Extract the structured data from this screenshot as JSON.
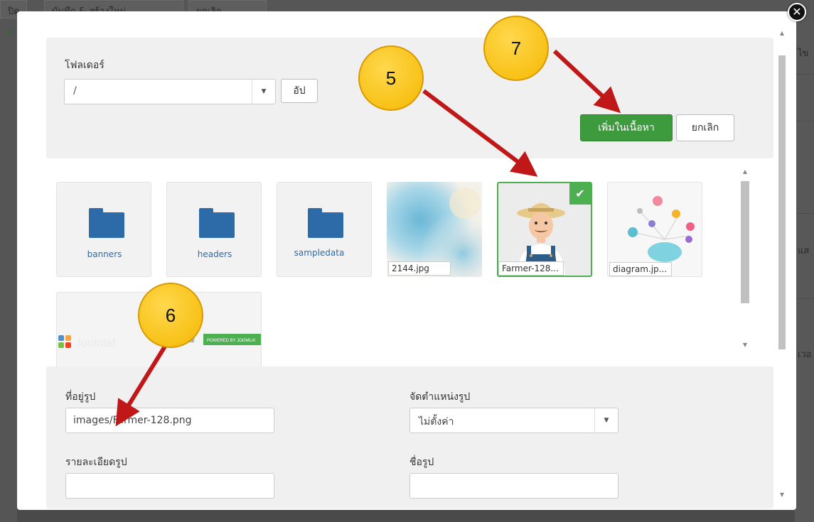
{
  "background": {
    "toolbar_buttons": [
      "ปิด",
      "บันทึก & สร้างใหม่",
      "ยกเลิก"
    ],
    "right_snippets": [
      "ไข",
      "แส",
      "เวอ"
    ]
  },
  "modal": {
    "close_icon": "close-icon",
    "folder_section": {
      "label": "โฟลเดอร์",
      "selected_folder": "/",
      "up_button": "อัป",
      "insert_button": "เพิ่มในเนื้อหา",
      "cancel_button": "ยกเลิก"
    },
    "media": {
      "folders": [
        {
          "name": "banners"
        },
        {
          "name": "headers"
        },
        {
          "name": "sampledata"
        }
      ],
      "images": [
        {
          "label": "2144.jpg"
        },
        {
          "label": "Farmer-128...",
          "selected": true
        },
        {
          "label": "diagram.jp..."
        }
      ],
      "joomla_banner": {
        "logo_text": "Joomla!",
        "small_text": "Joomla!",
        "powered_text": "POWERED BY JOOMLA!"
      }
    },
    "details": {
      "image_url_label": "ที่อยู่รูป",
      "image_url_value": "images/Farmer-128.png",
      "align_label": "จัดตำแหน่งรูป",
      "align_value": "ไม่ตั้งค่า",
      "description_label": "รายละเอียดรูป",
      "description_value": "",
      "title_label": "ชื่อรูป",
      "title_value": ""
    }
  },
  "callouts": [
    {
      "number": "5"
    },
    {
      "number": "6"
    },
    {
      "number": "7"
    }
  ],
  "colors": {
    "accent_green": "#3d9a3d",
    "folder_blue": "#2d6aa8",
    "callout_yellow": "#f5b800",
    "arrow_red": "#c01818"
  }
}
